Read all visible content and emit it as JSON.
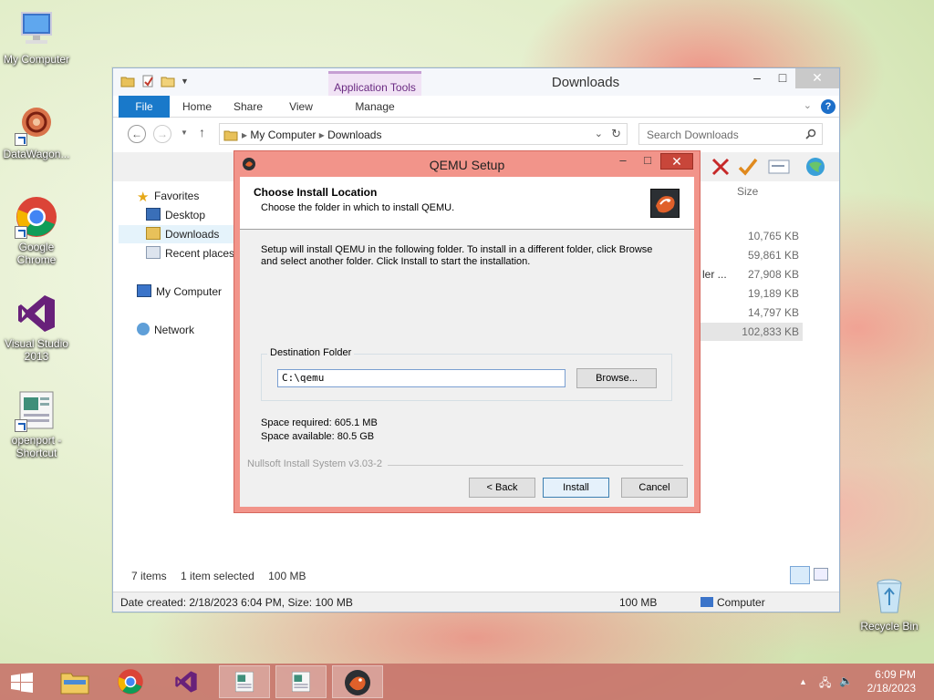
{
  "desktop": {
    "icons": [
      {
        "label": "My Computer"
      },
      {
        "label": "DataWagon..."
      },
      {
        "label": "Google Chrome"
      },
      {
        "label": "Visual Studio 2013"
      },
      {
        "label": "openport - Shortcut"
      },
      {
        "label": "Recycle Bin"
      }
    ]
  },
  "explorer": {
    "title": "Downloads",
    "context_tab": "Application Tools",
    "ribbon_tabs": [
      "File",
      "Home",
      "Share",
      "View",
      "Manage"
    ],
    "breadcrumb": [
      "My Computer",
      "Downloads"
    ],
    "search_placeholder": "Search Downloads",
    "nav": {
      "favorites": "Favorites",
      "desktop": "Desktop",
      "downloads": "Downloads",
      "recent": "Recent places",
      "computer": "My Computer",
      "network": "Network"
    },
    "size_header": "Size",
    "partial_name": "ler ...",
    "sizes": [
      "10,765 KB",
      "59,861 KB",
      "27,908 KB",
      "19,189 KB",
      "14,797 KB",
      "102,833 KB"
    ],
    "status": {
      "items": "7 items",
      "selected": "1 item selected",
      "selected_size": "100 MB"
    },
    "details_bar": {
      "created": "Date created: 2/18/2023 6:04 PM, Size: 100 MB",
      "size": "100 MB",
      "location": "Computer"
    }
  },
  "dialog": {
    "title": "QEMU Setup",
    "header_title": "Choose Install Location",
    "header_subtitle": "Choose the folder in which to install QEMU.",
    "description": "Setup will install QEMU in the following folder. To install in a different folder, click Browse and select another folder. Click Install to start the installation.",
    "dest_legend": "Destination Folder",
    "dest_value": "C:\\qemu",
    "browse_label": "Browse...",
    "space_required": "Space required: 605.1 MB",
    "space_available": "Space available: 80.5 GB",
    "nsis": "Nullsoft Install System v3.03-2",
    "back_label": "< Back",
    "install_label": "Install",
    "cancel_label": "Cancel"
  },
  "taskbar": {
    "time": "6:09 PM",
    "date": "2/18/2023"
  }
}
